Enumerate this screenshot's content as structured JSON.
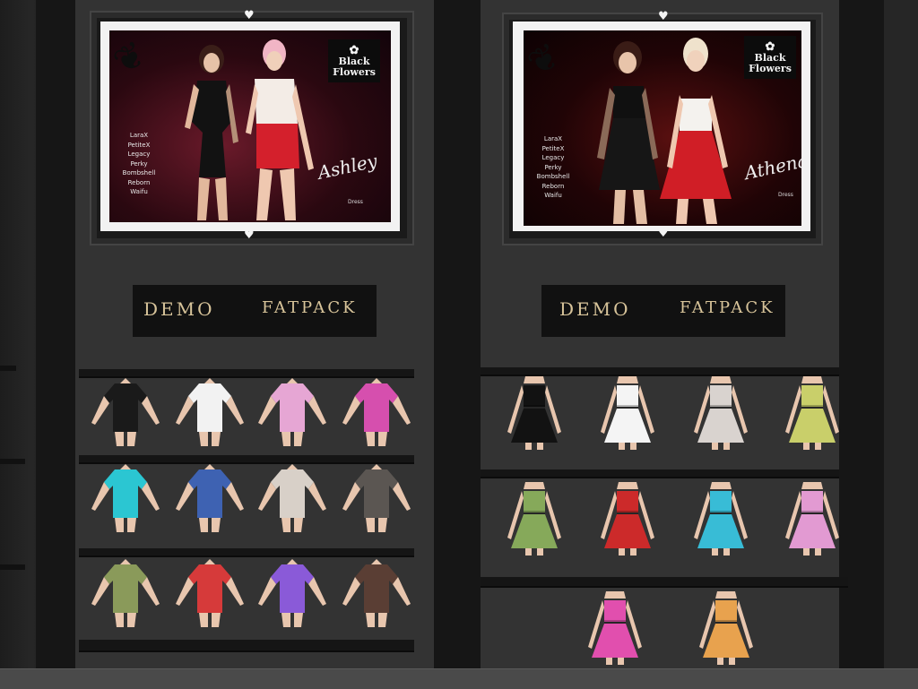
{
  "left_vendor": {
    "brand": {
      "line1": "Black",
      "line2": "Flowers"
    },
    "title_script": "Ashley",
    "subtitle": "Dress",
    "compatible_bodies": [
      "LaraX",
      "PetiteX",
      "Legacy",
      "Perky",
      "Bombshell",
      "Reborn",
      "Waifu"
    ],
    "sign": {
      "demo": "DEMO",
      "fatpack": "FATPACK"
    },
    "colors": [
      "#1a1a1a",
      "#f2f2f2",
      "#e6a6d4",
      "#d64fae",
      "#2bc6d2",
      "#3e62b2",
      "#d8d0c8",
      "#5b5652",
      "#8a9a5a",
      "#d63a3a",
      "#8a5ad8",
      "#5a3e34"
    ]
  },
  "right_vendor": {
    "brand": {
      "line1": "Black",
      "line2": "Flowers"
    },
    "title_script": "Athena",
    "subtitle": "Dress",
    "compatible_bodies": [
      "LaraX",
      "PetiteX",
      "Legacy",
      "Perky",
      "Bombshell",
      "Reborn",
      "Waifu"
    ],
    "sign": {
      "demo": "DEMO",
      "fatpack": "FATPACK"
    },
    "colors": [
      "#121212",
      "#f4f4f4",
      "#d9d3cf",
      "#c9cf6a",
      "#86a95a",
      "#cc2a2a",
      "#38bcd6",
      "#e29ad2",
      "#e14fae",
      "#e8a24e"
    ]
  },
  "icons": [
    "heart-icon",
    "leaf-icon",
    "flower-icon"
  ]
}
